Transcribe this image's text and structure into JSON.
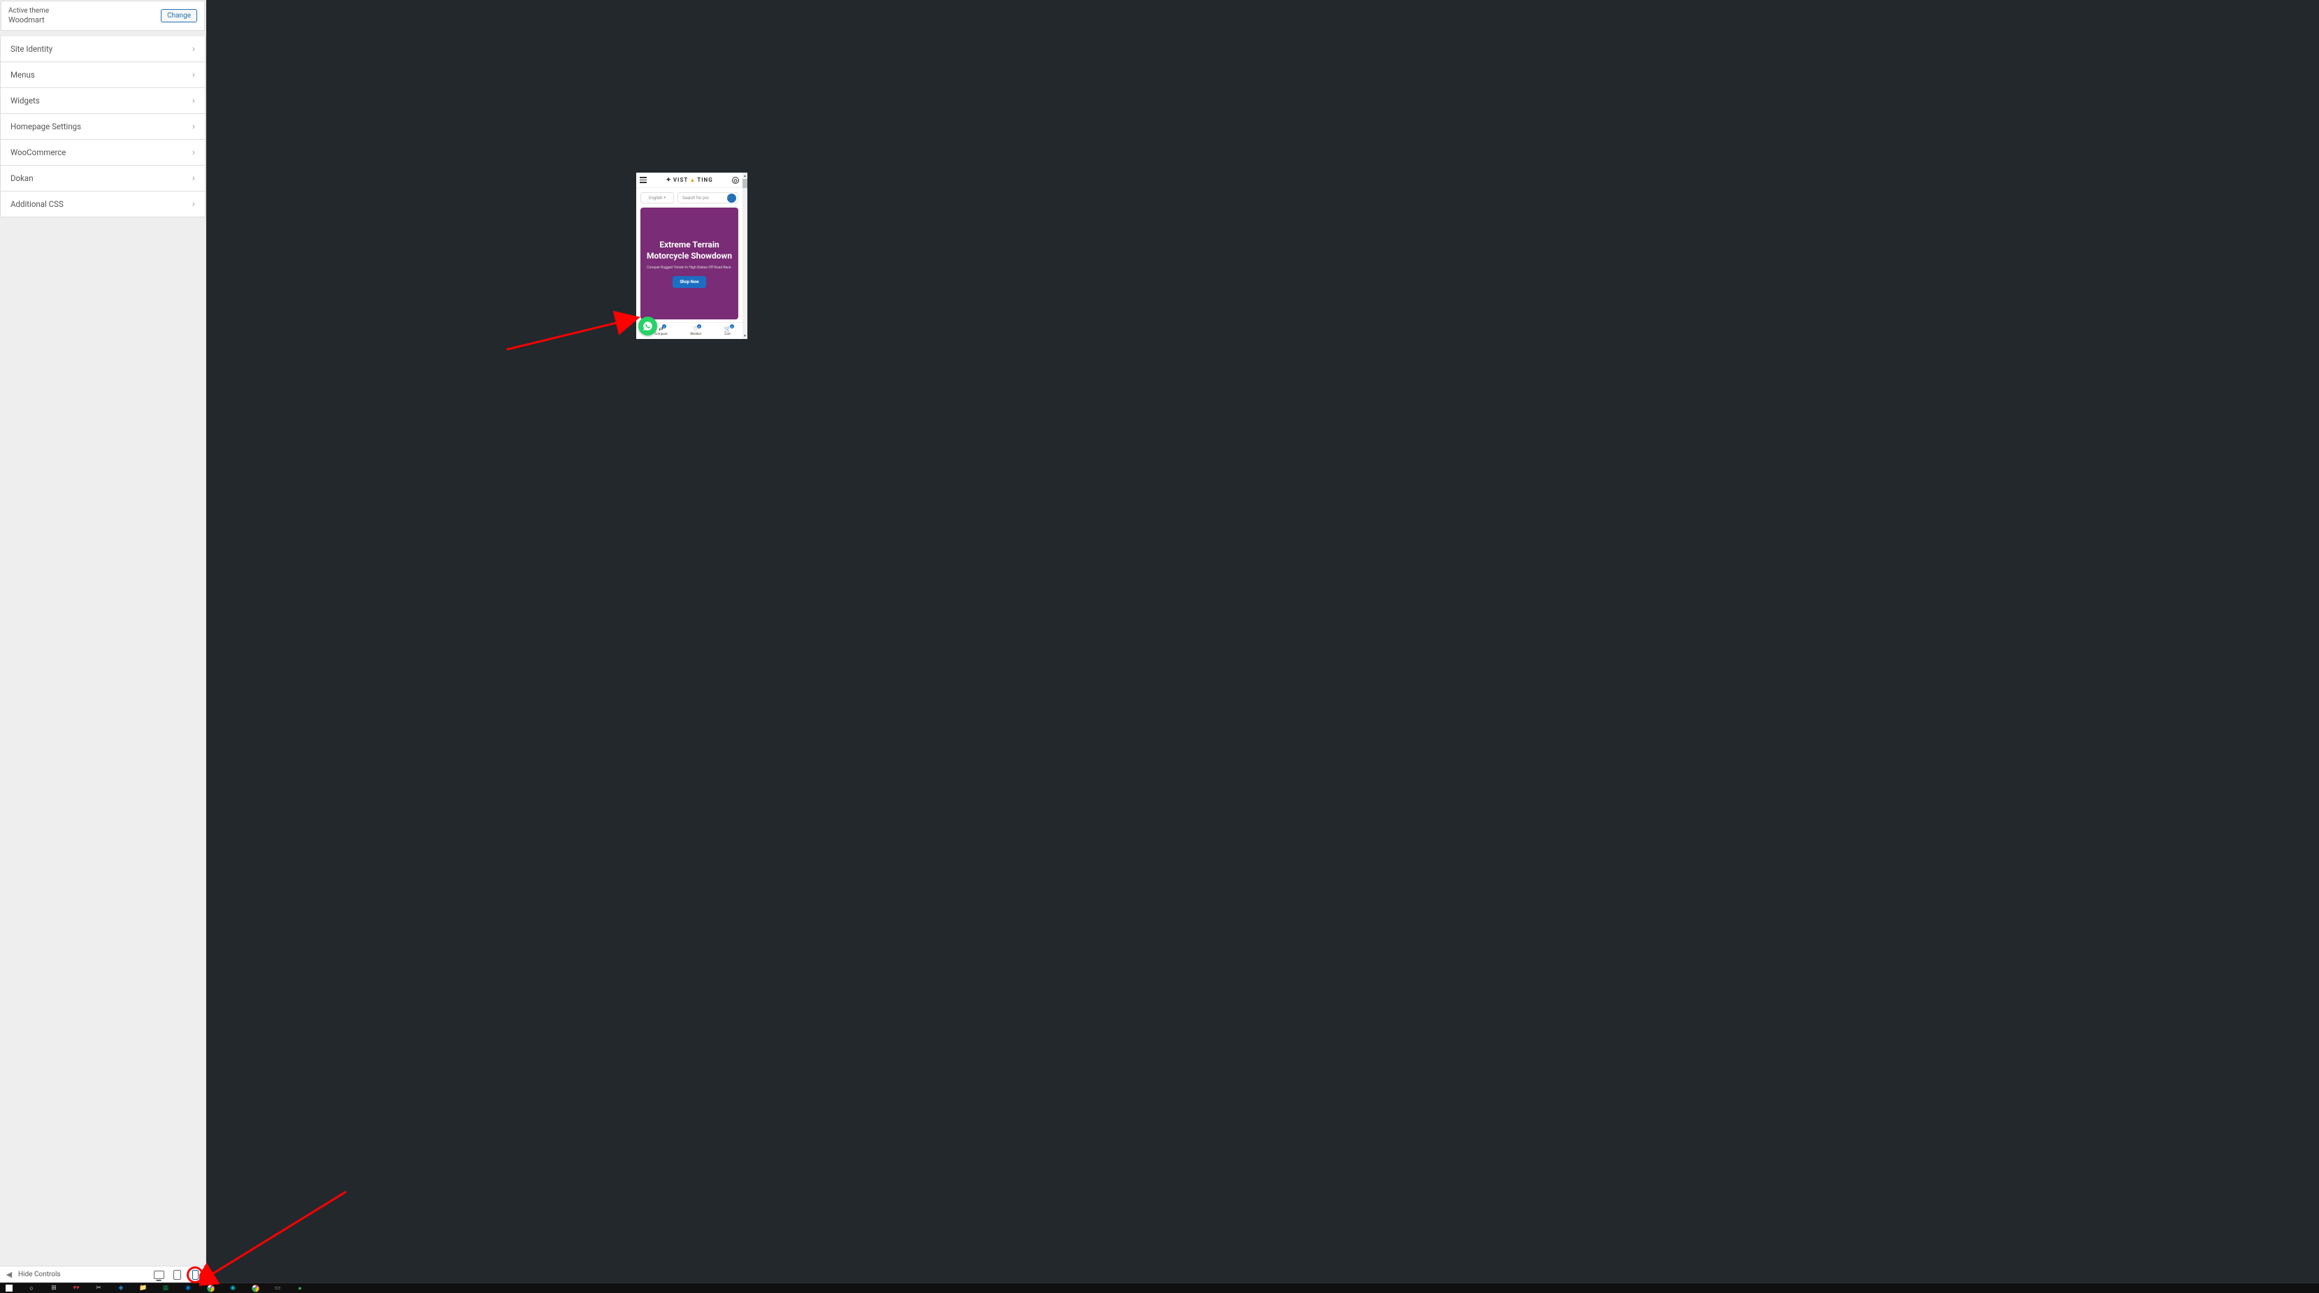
{
  "sidebar": {
    "theme_label": "Active theme",
    "theme_name": "Woodmart",
    "change_label": "Change",
    "items": [
      {
        "label": "Site Identity"
      },
      {
        "label": "Menus"
      },
      {
        "label": "Widgets"
      },
      {
        "label": "Homepage Settings"
      },
      {
        "label": "WooCommerce"
      },
      {
        "label": "Dokan"
      },
      {
        "label": "Additional CSS"
      }
    ]
  },
  "bottom_bar": {
    "hide_controls": "Hide Controls"
  },
  "preview": {
    "logo_text_1": "VIST",
    "logo_text_2": "TING",
    "lang": "English",
    "search_placeholder": "Search for pro",
    "hero_title": "Extreme Terrain Motorcycle Showdown",
    "hero_subtitle": "Conquer Rugged Terrain In High-Stakes Off-Road Race.",
    "shop_now": "Shop Now",
    "footer": [
      {
        "label": "Compare",
        "badge": "0"
      },
      {
        "label": "Wishlist",
        "badge": "0"
      },
      {
        "label": "Cart",
        "badge": "0"
      }
    ]
  },
  "colors": {
    "hero_bg": "#7a2c76",
    "accent_blue": "#1b6ec2",
    "whatsapp": "#25d366",
    "annotation_red": "#ff0000"
  }
}
